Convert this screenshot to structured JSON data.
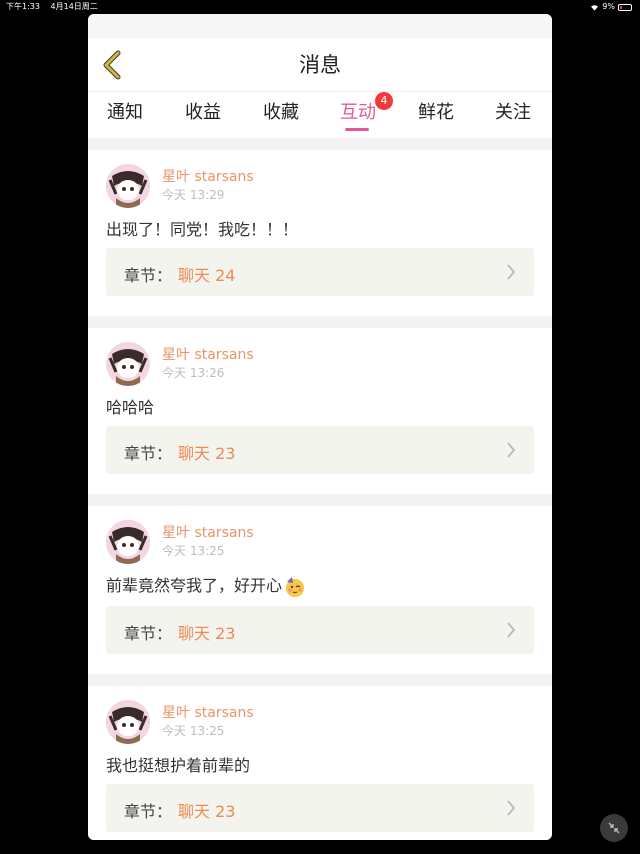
{
  "status_bar": {
    "time": "下午1:33",
    "date": "4月14日周二",
    "battery": "9%",
    "battery_color": "#e53935"
  },
  "header": {
    "back_icon": "chevron-left-icon",
    "title": "消息"
  },
  "tabs": [
    {
      "label": "通知",
      "active": false
    },
    {
      "label": "收益",
      "active": false
    },
    {
      "label": "收藏",
      "active": false
    },
    {
      "label": "互动",
      "active": true,
      "badge": "4"
    },
    {
      "label": "鲜花",
      "active": false
    },
    {
      "label": "关注",
      "active": false
    }
  ],
  "messages": [
    {
      "user": "星叶 starsans",
      "time": "今天 13:29",
      "text": "出现了！同党！我吃！！！",
      "chapter_label": "章节：",
      "chapter": "聊天 24"
    },
    {
      "user": "星叶 starsans",
      "time": "今天 13:26",
      "text": "哈哈哈",
      "chapter_label": "章节：",
      "chapter": "聊天 23"
    },
    {
      "user": "星叶 starsans",
      "time": "今天 13:25",
      "text": "前辈竟然夸我了，好开心",
      "emoji": "partying-face-emoji",
      "chapter_label": "章节：",
      "chapter": "聊天 23"
    },
    {
      "user": "星叶 starsans",
      "time": "今天 13:25",
      "text": "我也挺想护着前辈的",
      "chapter_label": "章节：",
      "chapter": "聊天 23"
    }
  ],
  "colors": {
    "accent": "#e6579a",
    "username": "#e8956a",
    "chapter": "#ee8a55",
    "back_icon": "#c9a227",
    "badge": "#f03b3b"
  },
  "corner_button_icon": "collapse-arrows-icon"
}
